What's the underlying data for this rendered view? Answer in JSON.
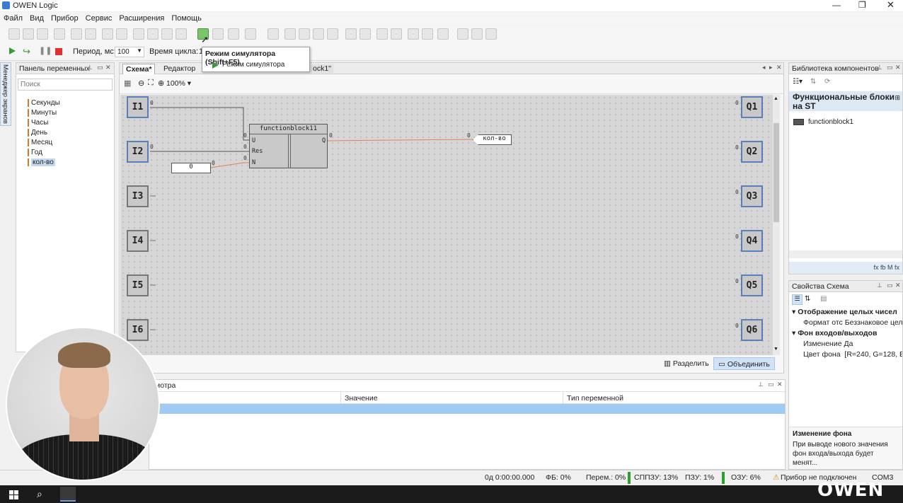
{
  "window": {
    "title": "OWEN Logic"
  },
  "menu": [
    "Файл",
    "Вид",
    "Прибор",
    "Сервис",
    "Расширения",
    "Помощь"
  ],
  "sim": {
    "period_label": "Период, мс:",
    "period_value": "100",
    "cycle_label": "Время цикла:",
    "cycle_value": "1"
  },
  "tooltip": {
    "title": "Режим симулятора (Shift+F5)",
    "item": "Режим симулятора"
  },
  "vars_panel": {
    "title": "Панель переменных",
    "search_placeholder": "Поиск",
    "items": [
      "Секунды",
      "Минуты",
      "Часы",
      "День",
      "Месяц",
      "Год",
      "кол-во"
    ],
    "sidetab": "Менеджер экранов"
  },
  "tabs": [
    "Схема*",
    "Редактор",
    "ock1\""
  ],
  "zoom": "100%",
  "inputs": [
    "I1",
    "I2",
    "I3",
    "I4",
    "I5",
    "I6"
  ],
  "outputs": [
    "Q1",
    "Q2",
    "Q3",
    "Q4",
    "Q5",
    "Q6"
  ],
  "pin_value": "0",
  "fb": {
    "name": "functionblock11",
    "inputs": [
      "U",
      "Res",
      "N"
    ],
    "output": "Q"
  },
  "const_value": "0",
  "out_var": "кол-во",
  "split": {
    "split_label": "Разделить",
    "merge_label": "Объединить"
  },
  "watch": {
    "title": "мотра",
    "col_value": "Значение",
    "col_type": "Тип переменной"
  },
  "library": {
    "title": "Библиотека компонентов",
    "header": "Функциональные блоки на ST",
    "item": "functionblock1",
    "footer_icons": "fx  fb  M  fx"
  },
  "props": {
    "title": "Свойства Схема",
    "group1": "Отображение целых чисел",
    "row1_name": "Формат отс",
    "row1_value": "Беззнаковое цело",
    "group2": "Фон входов/выходов",
    "row2_name": "Изменение",
    "row2_value": "Да",
    "row3_name": "Цвет фона",
    "row3_value": "[R=240, G=128, B=",
    "desc_title": "Изменение фона",
    "desc_text": "При выводе нового значения фон входа/выхода будет менят..."
  },
  "status": {
    "time": "0д 0:00:00.000",
    "fb": "ФБ: 0%",
    "vars": "Перем.: 0%",
    "sppzu": "СППЗУ: 13%",
    "pzu": "ПЗУ: 1%",
    "ozu": "ОЗУ: 6%",
    "device": "Прибор не подключен",
    "port": "COM3"
  },
  "logo": "OWEN",
  "colors": {
    "accent": "#5b7fb8",
    "wire": "#e08060",
    "tab_blue": "#c5daf2"
  }
}
